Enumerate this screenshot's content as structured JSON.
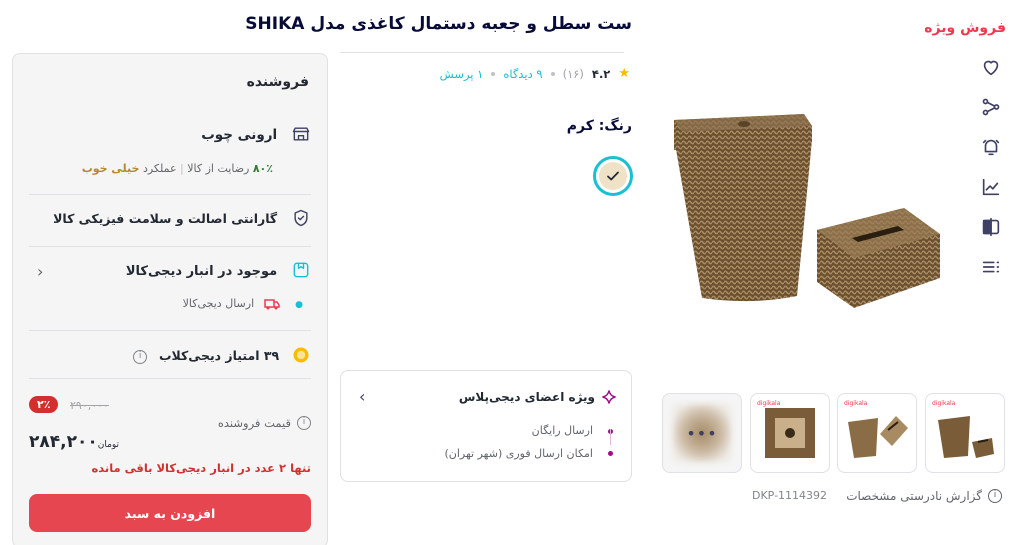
{
  "gallery": {
    "special_sale": "فروش ویژه",
    "icons": [
      "heart-icon",
      "share-icon",
      "bell-icon",
      "chart-icon",
      "compare-icon",
      "list-icon"
    ],
    "thumb_brand": "digikala",
    "more_dots": "•••",
    "report_label": "گزارش نادرستی مشخصات",
    "dkp": "DKP-1114392"
  },
  "product": {
    "title": "ست سطل و جعبه دستمال کاغذی مدل SHIKA",
    "rating": "۴.۲",
    "rating_count": "(۱۶)",
    "reviews": "۹ دیدگاه",
    "questions": "۱ پرسش",
    "color_label": "رنگ: کرم",
    "color_hex": "#f0e2c7"
  },
  "plus": {
    "title": "ویژه اعضای دیجی‌پلاس",
    "features": [
      "ارسال رایگان",
      "امکان ارسال فوری (شهر تهران)"
    ]
  },
  "seller": {
    "heading": "فروشنده",
    "name": "ارونی چوب",
    "satisfaction": "۸۰٪",
    "satisfaction_label": "رضایت از کالا",
    "performance_label": "عملکرد",
    "performance_value": "خیلی خوب",
    "guarantee": "گارانتی اصالت و سلامت فیزیکی کالا",
    "stock_title": "موجود در انبار دیجی‌کالا",
    "shipping": "ارسال دیجی‌کالا",
    "club_points": "۳۹ امتیاز دیجی‌کلاب",
    "price_label": "قیمت فروشنده",
    "old_price": "۲۹۰,۰۰۰",
    "discount": "۲٪",
    "price": "۲۸۴,۲۰۰",
    "currency": "تومان",
    "stock_warning": "تنها ۲ عدد در انبار دیجی‌کالا باقی مانده",
    "add_to_cart": "افزودن به سبد"
  }
}
